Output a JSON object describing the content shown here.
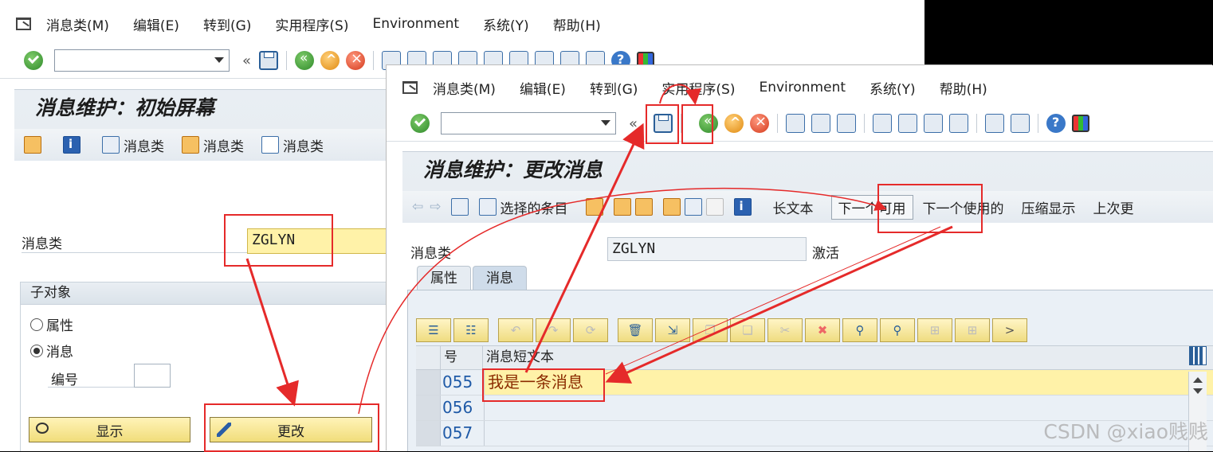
{
  "win1": {
    "menu": [
      "消息类(M)",
      "编辑(E)",
      "转到(G)",
      "实用程序(S)",
      "Environment",
      "系统(Y)",
      "帮助(H)"
    ],
    "screen_title": "消息维护：初始屏幕",
    "appbar": [
      "消息类",
      "消息类",
      "消息类"
    ],
    "field_label": "消息类",
    "field_value": "ZGLYN",
    "group_title": "子对象",
    "radio_attr": "属性",
    "radio_msg": "消息",
    "number_label": "编号",
    "btn_display": "显示",
    "btn_change": "更改"
  },
  "win2": {
    "menu": [
      "消息类(M)",
      "编辑(E)",
      "转到(G)",
      "实用程序(S)",
      "Environment",
      "系统(Y)",
      "帮助(H)"
    ],
    "screen_title": "消息维护：更改消息",
    "appbar": {
      "selected": "选择的条目",
      "long_text": "长文本",
      "next_free": "下一个可用",
      "next_used": "下一个使用的",
      "compress": "压缩显示",
      "last_change": "上次更"
    },
    "field_label": "消息类",
    "field_value": "ZGLYN",
    "status": "激活",
    "tabs": [
      "属性",
      "消息"
    ],
    "tc_more": ">",
    "grid": {
      "col_no": "号",
      "col_text": "消息短文本",
      "rows": [
        {
          "no": "055",
          "text": "我是一条消息"
        },
        {
          "no": "056",
          "text": ""
        },
        {
          "no": "057",
          "text": ""
        }
      ]
    }
  },
  "watermark": "CSDN @xiao贱贱",
  "colors": {
    "annotation": "#e52a2a",
    "input_highlight": "#fff2a8",
    "button": "#f1dd7a"
  }
}
